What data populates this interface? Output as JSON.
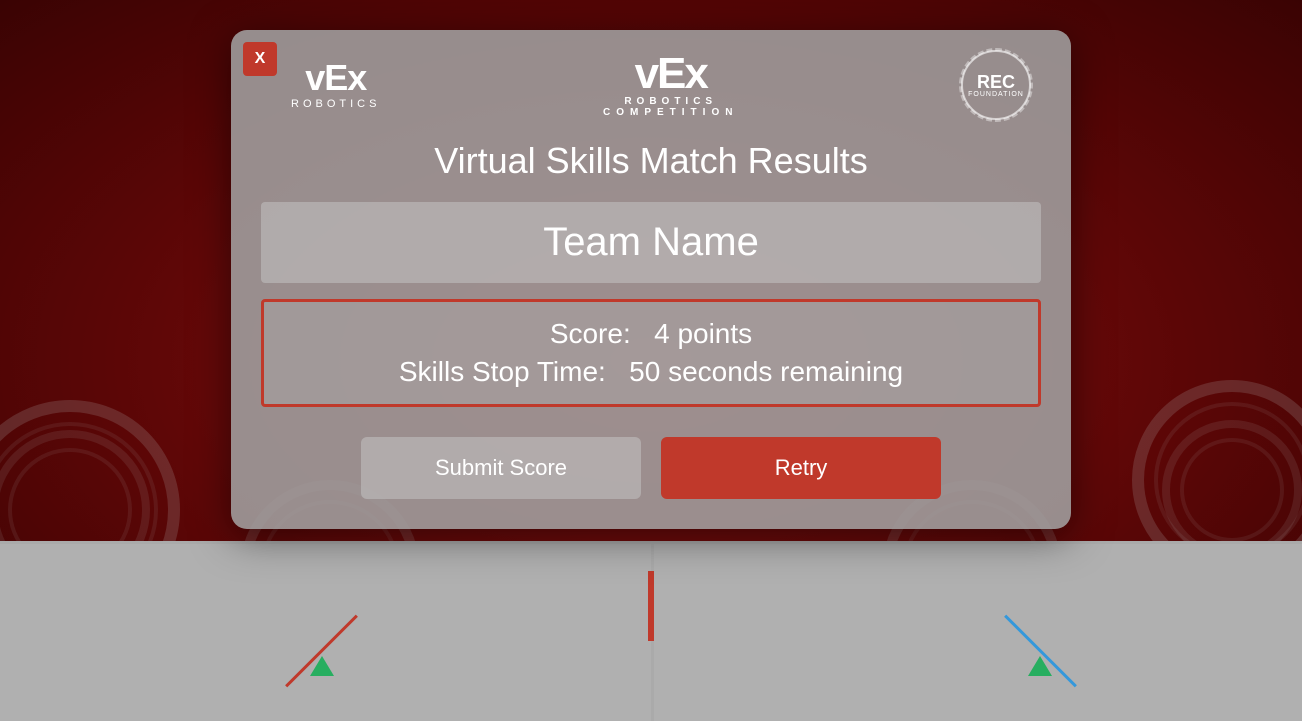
{
  "background": {
    "color": "#7a0a0a"
  },
  "modal": {
    "title": "Virtual Skills Match Results",
    "close_button_label": "X",
    "logo_left": {
      "vex_text": "vEx",
      "robotics_text": "ROBOTICS"
    },
    "logo_center": {
      "vex_text": "vEx",
      "robotics_text": "ROBOTICS",
      "competition_text": "COMPETITION"
    },
    "logo_rec": {
      "rec_text": "REC",
      "foundation_text": "FOUNDATION"
    },
    "team_name": "Team Name",
    "score_label": "Score:",
    "score_value": "4 points",
    "stop_time_label": "Skills Stop Time:",
    "stop_time_value": "50 seconds remaining",
    "submit_button_label": "Submit Score",
    "retry_button_label": "Retry"
  }
}
